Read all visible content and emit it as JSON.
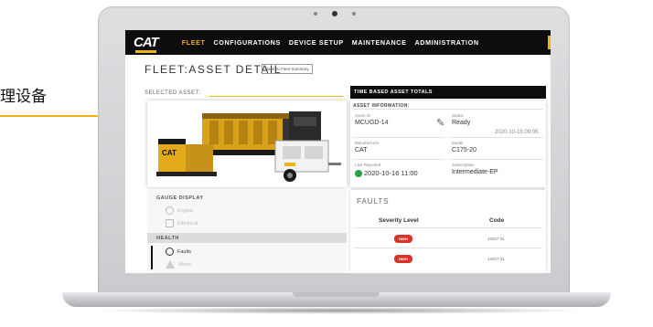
{
  "annotation": {
    "label": "理设备"
  },
  "nav": {
    "logo": "CAT",
    "items": [
      "FLEET",
      "CONFIGURATIONS",
      "DEVICE SETUP",
      "MAINTENANCE",
      "ADMINISTRATION"
    ]
  },
  "page": {
    "title": "FLEET:ASSET DETAIL",
    "back_button": "Back To Fleet Summary",
    "selected_asset_label": "SELECTED ASSET:"
  },
  "totals_bar": "TIME BASED ASSET TOTALS",
  "asset_info": {
    "heading": "ASSET INFORMATION:",
    "asset_id_label": "Asset ID",
    "asset_id": "MCUGD-14",
    "status_label": "Status",
    "status": "Ready",
    "status_time": "2020-10-15 09:05",
    "manufacturer_label": "Manufacturer",
    "manufacturer": "CAT",
    "model_label": "Model",
    "model": "C175-20",
    "last_reported_label": "Last Reported",
    "last_reported": "2020-10-16 11:00",
    "subscription_label": "Subscription",
    "subscription": "Intermediate-EP"
  },
  "side_panel": {
    "gauges_heading": "GAUGE DISPLAY",
    "gauges": [
      "Engine",
      "Electrical"
    ],
    "health_heading": "HEALTH",
    "health_items": [
      "Faults",
      "Alerts"
    ]
  },
  "faults": {
    "heading": "FAULTS",
    "col_severity": "Severity Level",
    "col_code": "Code",
    "rows": [
      {
        "severity": "HIGH",
        "code": "J4007-31"
      },
      {
        "severity": "HIGH",
        "code": "J4007-31"
      }
    ]
  },
  "colors": {
    "accent": "#f0b316",
    "nav_bg": "#0d0d0d",
    "high": "#d9332a",
    "ok": "#2e9e47"
  }
}
